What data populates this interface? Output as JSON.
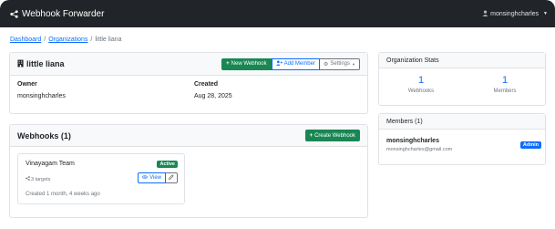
{
  "navbar": {
    "brand": "Webhook Forwarder",
    "brand_icon": "share-nodes-icon",
    "user": "monsinghcharles",
    "user_icon": "user-icon"
  },
  "breadcrumb": {
    "items": [
      "Dashboard",
      "Organizations",
      "little liana"
    ],
    "separator": "/"
  },
  "org": {
    "name": "little liana",
    "icon": "building-icon",
    "owner_label": "Owner",
    "owner": "monsinghcharles",
    "created_label": "Created",
    "created": "Aug 28, 2025",
    "new_webhook": "New Webhook",
    "add_member": "Add Member",
    "settings": "Settings"
  },
  "webhooks": {
    "title": "Webhooks (1)",
    "create_button": "Create Webhook",
    "items": [
      {
        "name": "Vinayagam Team",
        "status": "Active",
        "targets": "3 targets",
        "created": "Created 1 month, 4 weeks ago",
        "view_label": "View"
      }
    ]
  },
  "stats": {
    "title": "Organization Stats",
    "webhooks_value": "1",
    "webhooks_label": "Webhooks",
    "members_value": "1",
    "members_label": "Members"
  },
  "members": {
    "title": "Members (1)",
    "items": [
      {
        "name": "monsinghcharles",
        "email": "monsinghcharles@gmail.com",
        "role": "Admin"
      }
    ]
  },
  "colors": {
    "navbar": "#212529",
    "primary": "#0d6efd",
    "success": "#198754",
    "muted": "#6c757d",
    "border": "#dfe2e6"
  }
}
